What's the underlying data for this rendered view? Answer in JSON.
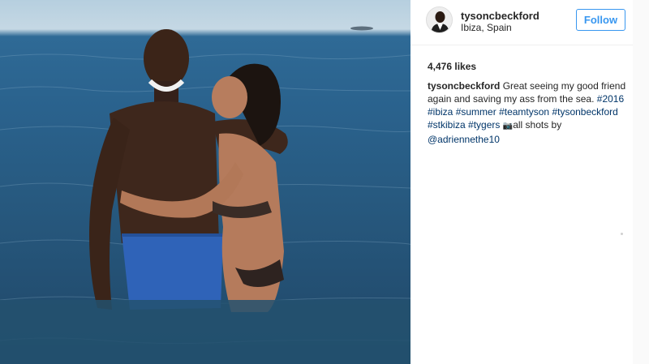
{
  "post": {
    "username": "tysoncbeckford",
    "location": "Ibiza, Spain",
    "follow_label": "Follow",
    "likes": "4,476 likes",
    "caption": {
      "user": "tysoncbeckford",
      "text1": " Great seeing my good friend again and saving my ass from the sea. ",
      "tags": [
        "#2016",
        "#ibiza",
        "#summer",
        "#teamtyson",
        "#tysonbeckford",
        "#stkibiza",
        "#tygers"
      ],
      "camera_icon": "camera-emoji-icon",
      "text2": "all shots by ",
      "mention": "@adriennethe10"
    }
  },
  "colors": {
    "accent": "#3897f0",
    "tag": "#003569",
    "text": "#262626",
    "sea": "#27597f"
  }
}
